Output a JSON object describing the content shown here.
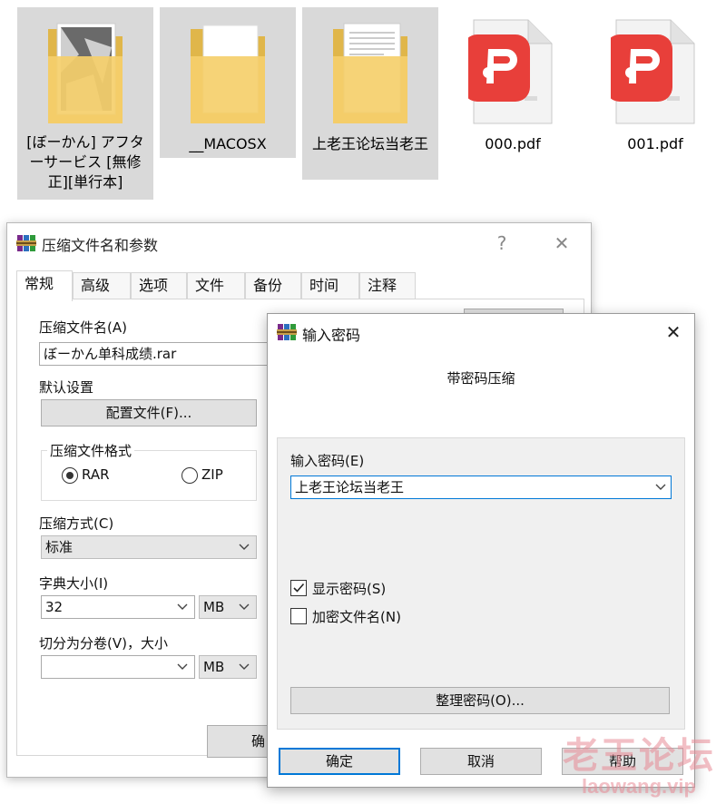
{
  "files": [
    {
      "label": "[ぼーかん] アフターサービス [無修正][単行本]",
      "type": "folder",
      "selected": true
    },
    {
      "label": "__MACOSX",
      "type": "folder",
      "selected": true
    },
    {
      "label": "上老王论坛当老王",
      "type": "folder",
      "selected": true
    },
    {
      "label": "000.pdf",
      "type": "pdf",
      "selected": false
    },
    {
      "label": "001.pdf",
      "type": "pdf",
      "selected": false
    }
  ],
  "archive_dialog": {
    "title": "压缩文件名和参数",
    "help_label": "?",
    "close_label": "✕",
    "tabs": [
      "常规",
      "高级",
      "选项",
      "文件",
      "备份",
      "时间",
      "注释"
    ],
    "active_tab": "常规",
    "archive_name_label": "压缩文件名(A)",
    "archive_name_value": "ぼーかん单科成绩.rar",
    "default_settings_label": "默认设置",
    "profiles_button": "配置文件(F)...",
    "format_group_label": "压缩文件格式",
    "format_options": [
      "RAR",
      "ZIP"
    ],
    "format_selected": "RAR",
    "method_label": "压缩方式(C)",
    "method_value": "标准",
    "dict_label": "字典大小(I)",
    "dict_value": "32",
    "dict_unit": "MB",
    "split_label": "切分为分卷(V)，大小",
    "split_value": "",
    "split_unit": "MB",
    "ok_button_partial": "确"
  },
  "password_dialog": {
    "title": "输入密码",
    "close_label": "✕",
    "subtitle": "带密码压缩",
    "enter_label": "输入密码(E)",
    "password_value": "上老王论坛当老王",
    "show_password_label": "显示密码(S)",
    "show_password_checked": true,
    "encrypt_names_label": "加密文件名(N)",
    "encrypt_names_checked": false,
    "organize_button": "整理密码(O)...",
    "ok_button": "确定",
    "cancel_button": "取消",
    "help_button": "帮助"
  },
  "watermark": {
    "top": "老王论坛",
    "bottom": "laowang.vip"
  },
  "colors": {
    "folder_yellow": "#f5cf6b",
    "pdf_red": "#e83f3a",
    "selection_gray": "#d9d9d9",
    "focus_blue": "#0078d7",
    "watermark_pink": "#e88b96"
  }
}
